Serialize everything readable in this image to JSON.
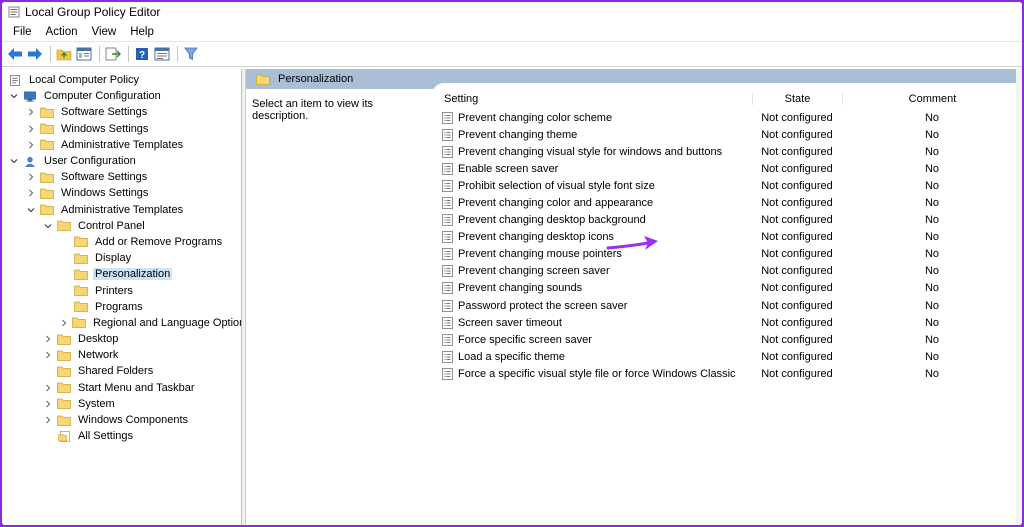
{
  "window": {
    "title": "Local Group Policy Editor"
  },
  "menu": [
    "File",
    "Action",
    "View",
    "Help"
  ],
  "toolbar": {
    "icons": [
      "back-arrow-icon",
      "forward-arrow-icon",
      "up-folder-icon",
      "show-hide-tree-icon",
      "export-list-icon",
      "help-icon",
      "properties-view-icon",
      "filter-icon"
    ]
  },
  "tree": [
    {
      "label": "Local Computer Policy",
      "depth": 0,
      "chevron": "none",
      "icon": "policy",
      "selected": false
    },
    {
      "label": "Computer Configuration",
      "depth": 0,
      "chevron": "down",
      "icon": "computer",
      "selected": false
    },
    {
      "label": "Software Settings",
      "depth": 1,
      "chevron": "right",
      "icon": "folder",
      "selected": false
    },
    {
      "label": "Windows Settings",
      "depth": 1,
      "chevron": "right",
      "icon": "folder",
      "selected": false
    },
    {
      "label": "Administrative Templates",
      "depth": 1,
      "chevron": "right",
      "icon": "folder",
      "selected": false
    },
    {
      "label": "User Configuration",
      "depth": 0,
      "chevron": "down",
      "icon": "user",
      "selected": false
    },
    {
      "label": "Software Settings",
      "depth": 1,
      "chevron": "right",
      "icon": "folder",
      "selected": false
    },
    {
      "label": "Windows Settings",
      "depth": 1,
      "chevron": "right",
      "icon": "folder",
      "selected": false
    },
    {
      "label": "Administrative Templates",
      "depth": 1,
      "chevron": "down",
      "icon": "folder",
      "selected": false
    },
    {
      "label": "Control Panel",
      "depth": 2,
      "chevron": "down",
      "icon": "folder",
      "selected": false
    },
    {
      "label": "Add or Remove Programs",
      "depth": 3,
      "chevron": "none",
      "icon": "folder",
      "selected": false
    },
    {
      "label": "Display",
      "depth": 3,
      "chevron": "none",
      "icon": "folder",
      "selected": false
    },
    {
      "label": "Personalization",
      "depth": 3,
      "chevron": "none",
      "icon": "folder",
      "selected": true
    },
    {
      "label": "Printers",
      "depth": 3,
      "chevron": "none",
      "icon": "folder",
      "selected": false
    },
    {
      "label": "Programs",
      "depth": 3,
      "chevron": "none",
      "icon": "folder",
      "selected": false
    },
    {
      "label": "Regional and Language Options",
      "depth": 3,
      "chevron": "right",
      "icon": "folder",
      "selected": false
    },
    {
      "label": "Desktop",
      "depth": 2,
      "chevron": "right",
      "icon": "folder",
      "selected": false
    },
    {
      "label": "Network",
      "depth": 2,
      "chevron": "right",
      "icon": "folder",
      "selected": false
    },
    {
      "label": "Shared Folders",
      "depth": 2,
      "chevron": "none",
      "icon": "folder",
      "selected": false
    },
    {
      "label": "Start Menu and Taskbar",
      "depth": 2,
      "chevron": "right",
      "icon": "folder",
      "selected": false
    },
    {
      "label": "System",
      "depth": 2,
      "chevron": "right",
      "icon": "folder",
      "selected": false
    },
    {
      "label": "Windows Components",
      "depth": 2,
      "chevron": "right",
      "icon": "folder",
      "selected": false
    },
    {
      "label": "All Settings",
      "depth": 2,
      "chevron": "none",
      "icon": "all-settings",
      "selected": false
    }
  ],
  "right_pane": {
    "header": "Personalization",
    "description": "Select an item to view its description.",
    "columns": {
      "setting": "Setting",
      "state": "State",
      "comment": "Comment"
    },
    "rows": [
      {
        "setting": "Prevent changing color scheme",
        "state": "Not configured",
        "comment": "No"
      },
      {
        "setting": "Prevent changing theme",
        "state": "Not configured",
        "comment": "No"
      },
      {
        "setting": "Prevent changing visual style for windows and buttons",
        "state": "Not configured",
        "comment": "No"
      },
      {
        "setting": "Enable screen saver",
        "state": "Not configured",
        "comment": "No"
      },
      {
        "setting": "Prohibit selection of visual style font size",
        "state": "Not configured",
        "comment": "No"
      },
      {
        "setting": "Prevent changing color and appearance",
        "state": "Not configured",
        "comment": "No"
      },
      {
        "setting": "Prevent changing desktop background",
        "state": "Not configured",
        "comment": "No"
      },
      {
        "setting": "Prevent changing desktop icons",
        "state": "Not configured",
        "comment": "No"
      },
      {
        "setting": "Prevent changing mouse pointers",
        "state": "Not configured",
        "comment": "No"
      },
      {
        "setting": "Prevent changing screen saver",
        "state": "Not configured",
        "comment": "No"
      },
      {
        "setting": "Prevent changing sounds",
        "state": "Not configured",
        "comment": "No"
      },
      {
        "setting": "Password protect the screen saver",
        "state": "Not configured",
        "comment": "No"
      },
      {
        "setting": "Screen saver timeout",
        "state": "Not configured",
        "comment": "No"
      },
      {
        "setting": "Force specific screen saver",
        "state": "Not configured",
        "comment": "No"
      },
      {
        "setting": "Load a specific theme",
        "state": "Not configured",
        "comment": "No"
      },
      {
        "setting": "Force a specific visual style file or force Windows Classic",
        "state": "Not configured",
        "comment": "No"
      }
    ]
  },
  "annotation": {
    "icon": "pointer-arrow-icon",
    "color": "#9b30f0"
  },
  "colors": {
    "frame": "#8a2be2",
    "header_band": "#a9bfd6",
    "selection": "#cce4f7",
    "folder": "#f7d774"
  }
}
